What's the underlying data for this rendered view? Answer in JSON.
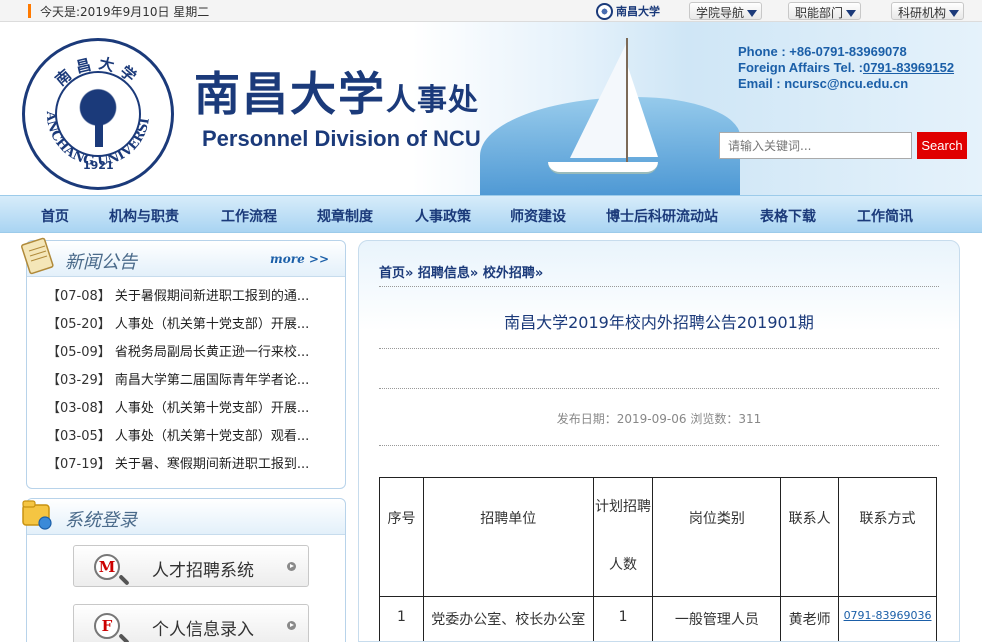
{
  "topbar": {
    "date": "今天是:2019年9月10日  星期二",
    "mini_logo_text": "南昌大学",
    "menus": [
      "学院导航",
      "职能部门",
      "科研机构"
    ]
  },
  "header": {
    "title_cn_main": "南昌大学",
    "title_cn_sub": "人事处",
    "title_en": "Personnel Division of NCU",
    "seal_year": "1921",
    "seal_ring_text": "NANCHANG UNIVERSITY",
    "seal_top_text": "南昌大学",
    "phone": "Phone : +86-0791-83969078",
    "foreign_label": "Foreign Affairs Tel. :",
    "foreign_tel": "0791-83969152",
    "email": "Email : ncursc@ncu.edu.cn",
    "search_placeholder": "请输入关键词...",
    "search_button": "Search"
  },
  "nav": [
    "首页",
    "机构与职责",
    "工作流程",
    "规章制度",
    "人事政策",
    "师资建设",
    "博士后科研流动站",
    "表格下载",
    "工作简讯"
  ],
  "news": {
    "title": "新闻公告",
    "more": "more >>",
    "items": [
      {
        "date": "【07-08】",
        "text": "关于暑假期间新进职工报到的通..."
      },
      {
        "date": "【05-20】",
        "text": "人事处（机关第十党支部）开展..."
      },
      {
        "date": "【05-09】",
        "text": "省税务局副局长黄正逊一行来校..."
      },
      {
        "date": "【03-29】",
        "text": "南昌大学第二届国际青年学者论..."
      },
      {
        "date": "【03-08】",
        "text": "人事处（机关第十党支部）开展..."
      },
      {
        "date": "【03-05】",
        "text": "人事处（机关第十党支部）观看..."
      },
      {
        "date": "【07-19】",
        "text": "关于暑、寒假期间新进职工报到..."
      }
    ]
  },
  "login": {
    "title": "系统登录",
    "buttons": [
      {
        "icon_letter": "M",
        "label": "人才招聘系统"
      },
      {
        "icon_letter": "F",
        "label": "个人信息录入"
      }
    ]
  },
  "article": {
    "breadcrumb": "首页» 招聘信息» 校外招聘»",
    "title": "南昌大学2019年校内外招聘公告201901期",
    "meta": "发布日期：2019-09-06 浏览数：311",
    "table": {
      "headers": [
        "序号",
        "招聘单位",
        "计划招聘人数",
        "岗位类别",
        "联系人",
        "联系方式"
      ],
      "rows": [
        [
          "1",
          "党委办公室、校长办公室",
          "1",
          "一般管理人员",
          "黄老师",
          "0791-83969036"
        ]
      ]
    }
  },
  "colors": {
    "brand": "#1b3a7a",
    "search_button": "#e00000",
    "accent_orange": "#ff7a00"
  }
}
